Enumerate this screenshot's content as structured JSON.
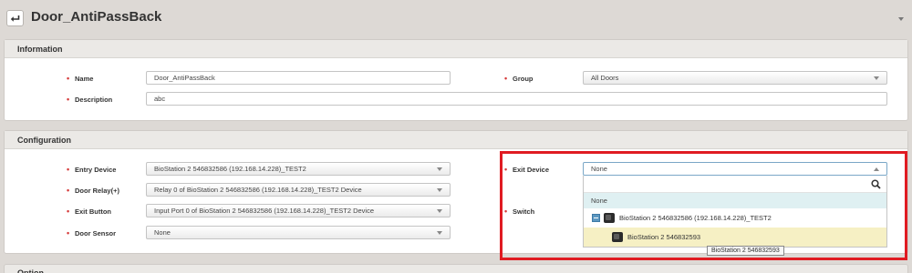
{
  "page": {
    "title": "Door_AntiPassBack"
  },
  "information": {
    "heading": "Information",
    "name": {
      "label": "Name",
      "value": "Door_AntiPassBack"
    },
    "description": {
      "label": "Description",
      "value": "abc"
    },
    "group": {
      "label": "Group",
      "value": "All Doors"
    }
  },
  "configuration": {
    "heading": "Configuration",
    "entry_device": {
      "label": "Entry Device",
      "value": "BioStation 2 546832586 (192.168.14.228)_TEST2"
    },
    "door_relay": {
      "label": "Door Relay(+)",
      "value": "Relay 0 of BioStation 2 546832586 (192.168.14.228)_TEST2 Device"
    },
    "exit_button": {
      "label": "Exit Button",
      "value": "Input Port 0 of BioStation 2 546832586 (192.168.14.228)_TEST2 Device"
    },
    "door_sensor": {
      "label": "Door Sensor",
      "value": "None"
    },
    "exit_device": {
      "label": "Exit Device",
      "value": "None",
      "options": {
        "none": "None",
        "parent": "BioStation 2 546832586 (192.168.14.228)_TEST2",
        "child": "BioStation 2 546832593"
      },
      "tooltip": "BioStation 2 546832593"
    },
    "switch": {
      "label": "Switch"
    }
  },
  "option": {
    "heading": "Option"
  },
  "colors": {
    "required": "#d63a3a",
    "highlight": "#e01b22",
    "selected_bg": "#f6f0c4",
    "none_bg": "#dff0f2"
  },
  "icons": {
    "back": "return-arrow-icon",
    "search": "search-icon",
    "collapse": "minus-toggle-icon",
    "device": "device-icon"
  }
}
